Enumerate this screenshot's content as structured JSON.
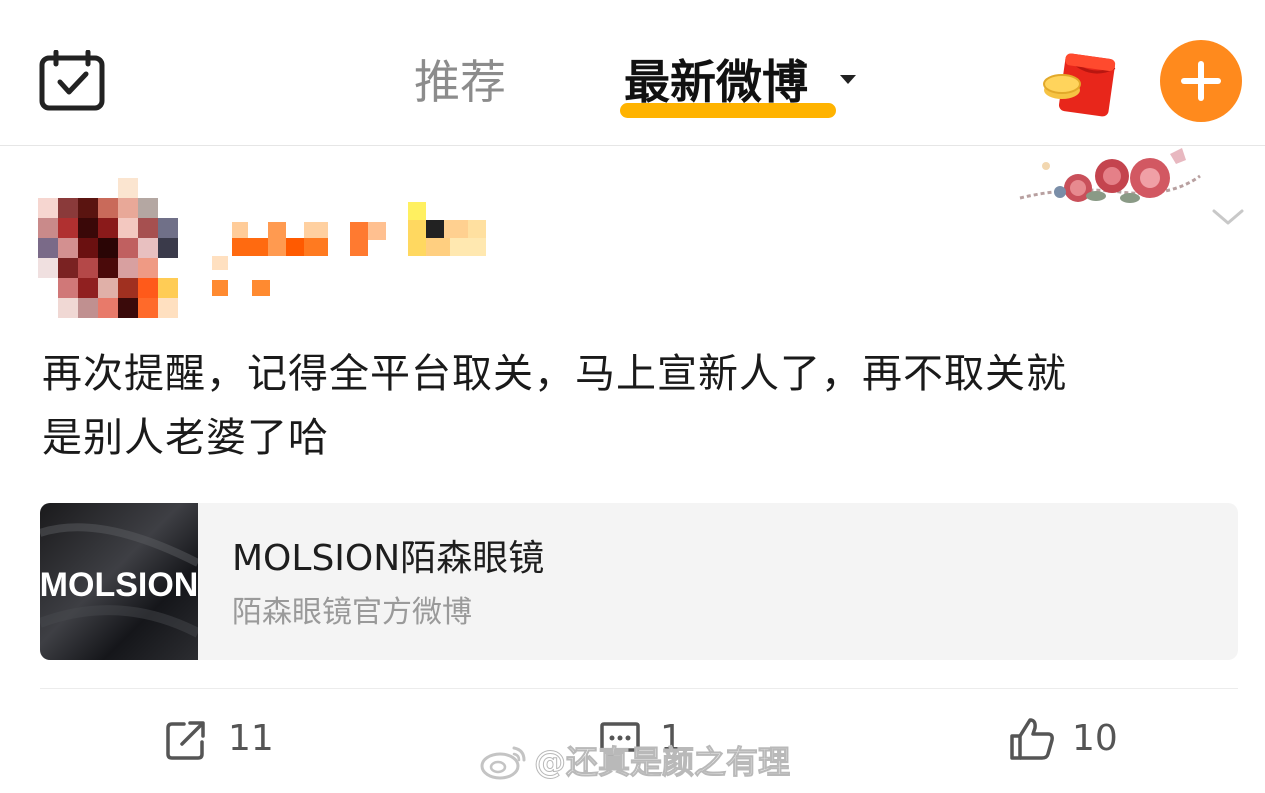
{
  "header": {
    "tabs": [
      {
        "label": "推荐",
        "active": false
      },
      {
        "label": "最新微博",
        "active": true
      }
    ],
    "accent_color": "#ffb300",
    "compose_button_color": "#ff8a1d",
    "icons": {
      "calendar": "calendar-check-icon",
      "red_packet": "red-packet-icon",
      "compose": "plus-icon",
      "tab_dropdown": "caret-down-icon"
    }
  },
  "post": {
    "author": {
      "name_visible": false,
      "avatar_icon": "pixelated-avatar"
    },
    "text_line1": "再次提醒，记得全平台取关，马上宣新人了，再不取关就",
    "text_line2": "是别人老婆了哈",
    "link_card": {
      "thumbnail_text": "MOLSION",
      "title": "MOLSION陌森眼镜",
      "subtitle": "陌森眼镜官方微博"
    },
    "actions": {
      "repost_count": "11",
      "comment_count": "1",
      "like_count": "10"
    }
  },
  "watermark": {
    "text": "@还真是颜之有理",
    "icon": "weibo-logo-icon"
  }
}
